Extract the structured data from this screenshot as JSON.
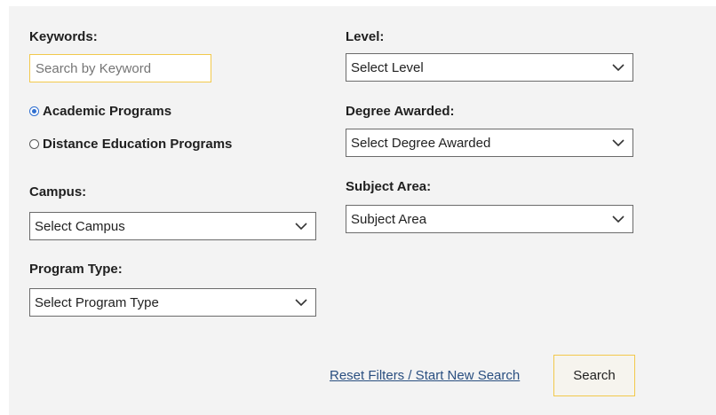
{
  "keywords": {
    "label": "Keywords:",
    "placeholder": "Search by Keyword",
    "value": "Search by Keyword"
  },
  "program_kind": {
    "options": [
      {
        "label": "Academic Programs",
        "checked": true
      },
      {
        "label": "Distance Education Programs",
        "checked": false
      }
    ]
  },
  "campus": {
    "label": "Campus:",
    "selected": "Select Campus"
  },
  "program_type": {
    "label": "Program Type:",
    "selected": "Select Program Type"
  },
  "level": {
    "label": "Level:",
    "selected": "Select Level"
  },
  "degree_awarded": {
    "label": "Degree Awarded:",
    "selected": "Select Degree Awarded"
  },
  "subject_area": {
    "label": "Subject Area:",
    "selected": "Subject Area"
  },
  "actions": {
    "reset_label": "Reset Filters / Start New Search",
    "search_label": "Search"
  },
  "colors": {
    "panel_bg": "#f3f3f3",
    "accent_border": "#f2c94c",
    "link": "#2a4f80",
    "radio_checked": "#2f6fd0"
  },
  "icons": {
    "select_indicator": "chevron-down-icon",
    "radio_checked": "radio-checked-icon",
    "radio_unchecked": "radio-unchecked-icon"
  }
}
